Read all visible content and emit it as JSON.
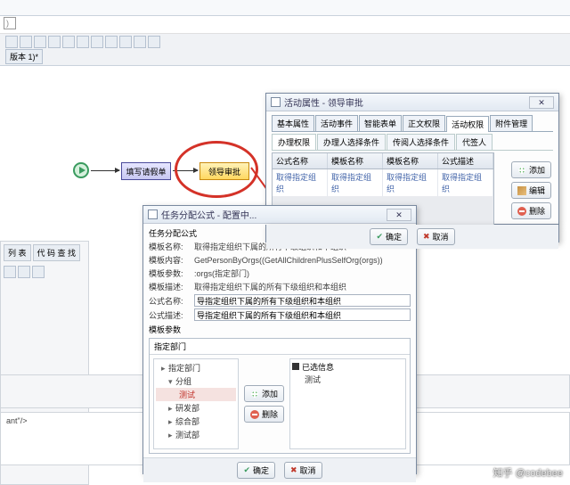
{
  "search": {
    "placeholder": ")"
  },
  "tab_label": "版本 1)*",
  "side": {
    "tab1": "列 表",
    "tab2": "代 码 查 找"
  },
  "bottom_text": "ant\"/>",
  "flow": {
    "node1": "填写请假单",
    "node2": "领导审批"
  },
  "dialog1": {
    "title": "活动属性 - 领导审批",
    "tabs": [
      "基本属性",
      "活动事件",
      "智能表单",
      "正文权限",
      "活动权限",
      "附件管理"
    ],
    "subtabs": [
      "办理权限",
      "办理人选择条件",
      "传阅人选择条件",
      "代签人"
    ],
    "grid_headers": [
      "公式名称",
      "模板名称",
      "模板名称",
      "公式描述"
    ],
    "grid_row": [
      "取得指定组织",
      "取得指定组织",
      "取得指定组织",
      "取得指定组织"
    ],
    "buttons": {
      "add": "添加",
      "edit": "编辑",
      "del": "删除"
    }
  },
  "dialog2": {
    "title": "任务分配公式 - 配置中...",
    "section": "任务分配公式",
    "fields": {
      "name_l": "模板名称:",
      "name_v": "取得指定组织下属的所有下级组织和本组织",
      "content_l": "模板内容:",
      "content_v": "GetPersonByOrgs((GetAllChildrenPlusSelfOrg(orgs))",
      "param_l": "模板参数:",
      "param_v": ":orgs(指定部门)",
      "desc_l": "模板描述:",
      "desc_v": "取得指定组织下属的所有下级组织和本组织",
      "formula_name_l": "公式名称:",
      "formula_name_v": "导指定组织下属的所有下级组织和本组织",
      "formula_desc_l": "公式描述:",
      "formula_desc_v": "导指定组织下属的所有下级组织和本组织"
    },
    "params_label": "模板参数",
    "tabbox_head": "指定部门",
    "tree": [
      "指定部门",
      "分组",
      "测试",
      "研发部",
      "综合部",
      "测试部"
    ],
    "tree_selected_index": 2,
    "right_head": "已选信息",
    "right_item": "测试",
    "mid": {
      "add": "添加",
      "del": "删除"
    }
  },
  "footer": {
    "ok": "确定",
    "cancel": "取消"
  },
  "watermark": "知乎 @codebee"
}
